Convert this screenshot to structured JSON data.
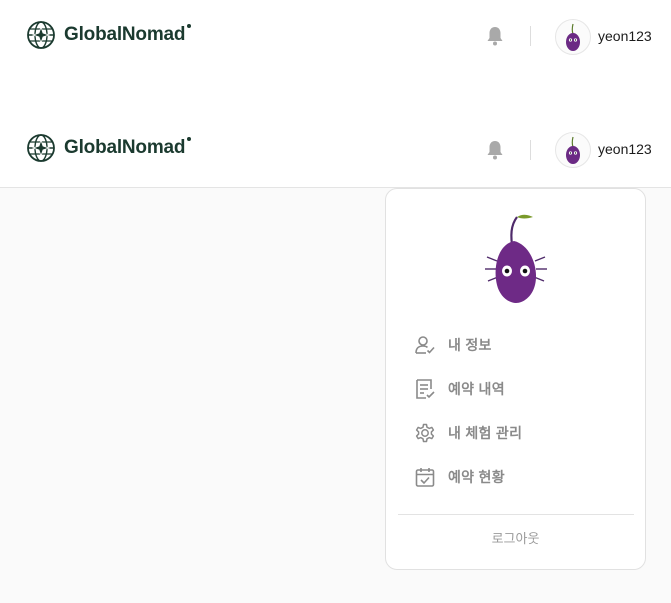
{
  "brand": {
    "name": "GlobalNomad",
    "accent": "#1b3a2f"
  },
  "user": {
    "username": "yeon123"
  },
  "icons": {
    "notification": "bell-icon",
    "logo": "globe-compass-icon"
  },
  "dropdown": {
    "items": [
      {
        "label": "내 정보",
        "icon": "user-check-icon"
      },
      {
        "label": "예약 내역",
        "icon": "document-list-icon"
      },
      {
        "label": "내 체험 관리",
        "icon": "gear-icon"
      },
      {
        "label": "예약 현황",
        "icon": "calendar-check-icon"
      }
    ],
    "logout_label": "로그아웃"
  }
}
